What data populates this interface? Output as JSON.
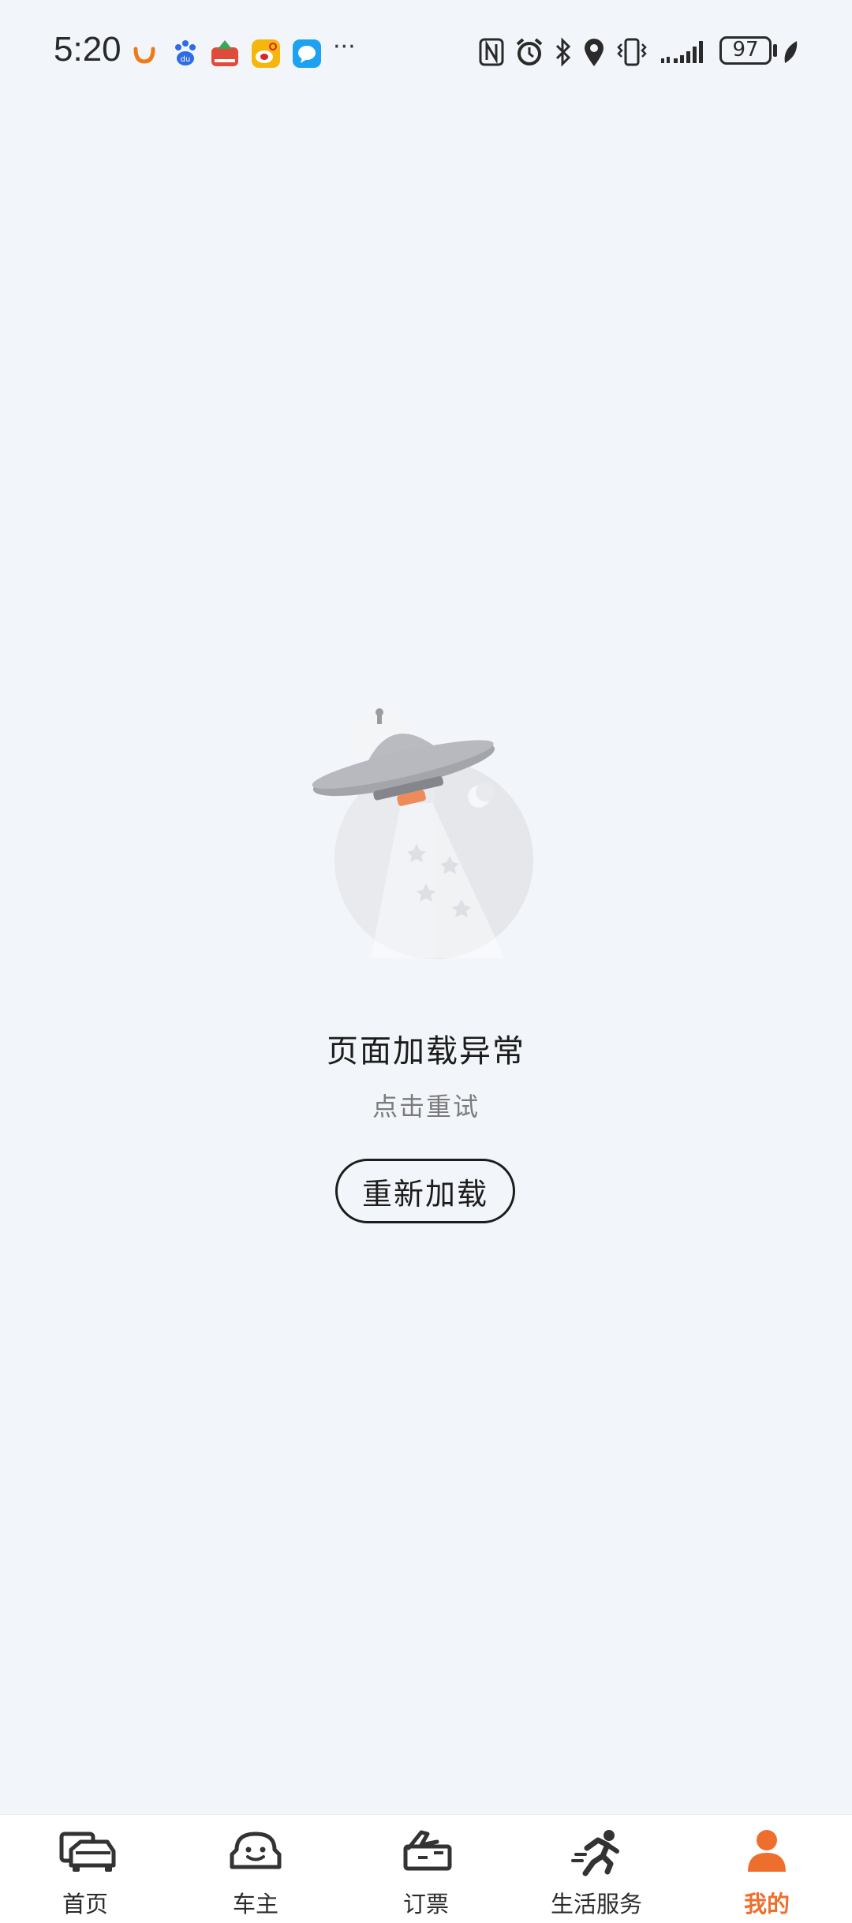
{
  "status_bar": {
    "time": "5:20",
    "more": "···",
    "battery": "97",
    "notification_icons": [
      "didi-icon",
      "baidu-icon",
      "app-icon",
      "weibo-icon",
      "message-icon"
    ],
    "system_icons": [
      "nfc-icon",
      "alarm-icon",
      "bluetooth-icon",
      "location-icon",
      "vibrate-icon",
      "signal-icon",
      "battery-icon",
      "leaf-icon"
    ]
  },
  "error": {
    "title": "页面加载异常",
    "subtitle": "点击重试",
    "reload_button": "重新加载",
    "illustration": "ufo-icon"
  },
  "tabbar": {
    "items": [
      {
        "label": "首页",
        "icon": "home-car-icon"
      },
      {
        "label": "车主",
        "icon": "car-owner-icon"
      },
      {
        "label": "订票",
        "icon": "ticket-icon"
      },
      {
        "label": "生活服务",
        "icon": "runner-icon"
      },
      {
        "label": "我的",
        "icon": "user-icon",
        "active": true
      }
    ]
  },
  "colors": {
    "background": "#f2f5f9",
    "accent": "#ee6f2d",
    "text": "#1c1c1c",
    "subtext": "#7b7b7b"
  }
}
